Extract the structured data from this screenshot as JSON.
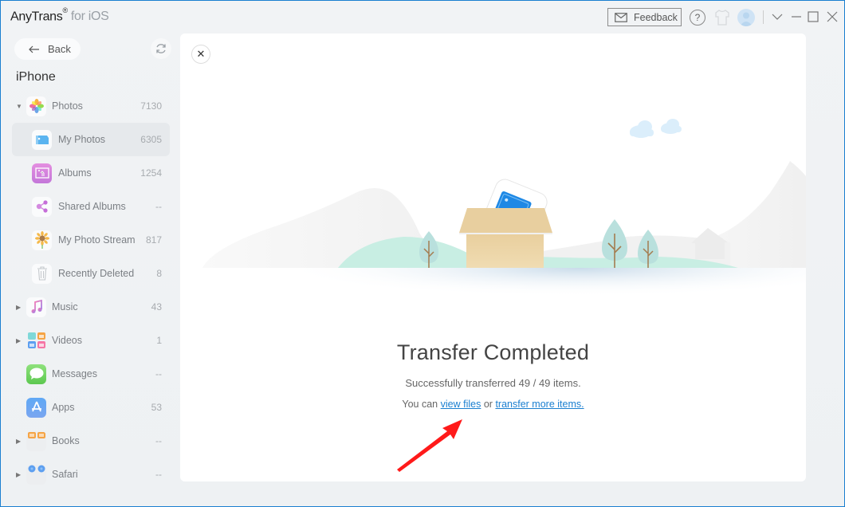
{
  "app": {
    "name": "AnyTrans",
    "registered": "®",
    "platform": "for iOS"
  },
  "titlebar": {
    "feedback_label": "Feedback",
    "help_glyph": "?"
  },
  "sidebar": {
    "back_label": "Back",
    "device_name": "iPhone",
    "items": [
      {
        "label": "Photos",
        "count": "7130",
        "icon": "photos-icon",
        "expanded": true,
        "level": "top"
      },
      {
        "label": "My Photos",
        "count": "6305",
        "icon": "my-photos-icon",
        "level": "sub",
        "active": true
      },
      {
        "label": "Albums",
        "count": "1254",
        "icon": "albums-icon",
        "level": "sub"
      },
      {
        "label": "Shared Albums",
        "count": "--",
        "icon": "shared-albums-icon",
        "level": "sub"
      },
      {
        "label": "My Photo Stream",
        "count": "817",
        "icon": "photo-stream-icon",
        "level": "sub"
      },
      {
        "label": "Recently Deleted",
        "count": "8",
        "icon": "trash-icon",
        "level": "sub"
      },
      {
        "label": "Music",
        "count": "43",
        "icon": "music-icon",
        "level": "top"
      },
      {
        "label": "Videos",
        "count": "1",
        "icon": "videos-icon",
        "level": "top"
      },
      {
        "label": "Messages",
        "count": "--",
        "icon": "messages-icon",
        "level": "top"
      },
      {
        "label": "Apps",
        "count": "53",
        "icon": "apps-icon",
        "level": "top"
      },
      {
        "label": "Books",
        "count": "--",
        "icon": "books-icon",
        "level": "top"
      },
      {
        "label": "Safari",
        "count": "--",
        "icon": "safari-icon",
        "level": "top"
      }
    ]
  },
  "main": {
    "close_glyph": "✕",
    "title": "Transfer Completed",
    "subtitle": "Successfully transferred 49 / 49 items.",
    "links_prefix": "You can",
    "link_view_files": "view files",
    "links_middle": "or",
    "link_transfer_more": "transfer more items."
  },
  "colors": {
    "accent": "#1a7fd0",
    "annotation_arrow": "#ff1a1a"
  }
}
